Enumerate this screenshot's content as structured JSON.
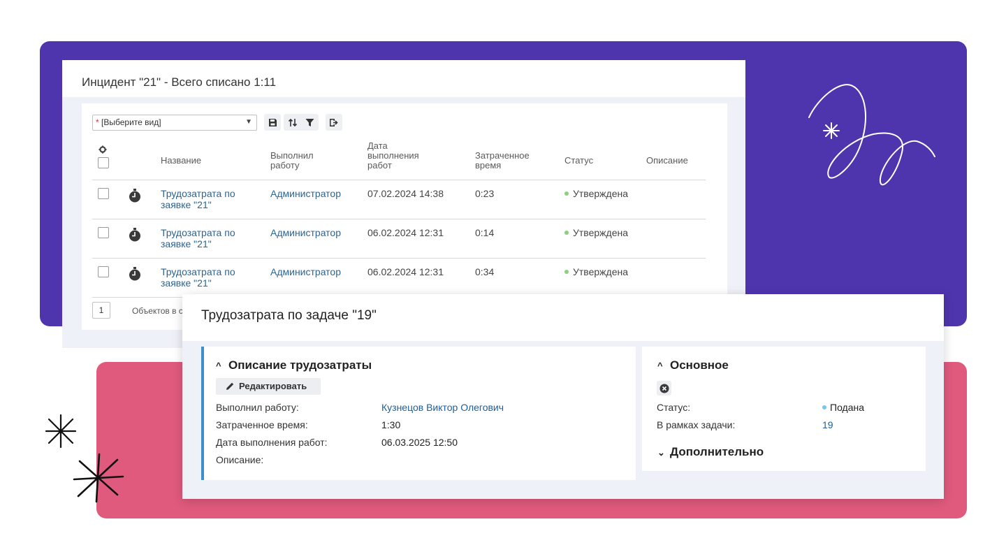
{
  "incident_window": {
    "title": "Инцидент \"21\" - Всего списано 1:11",
    "toolbar": {
      "view_select_required": "*",
      "view_select_value": "[Выберите вид]",
      "icons": [
        "save-icon",
        "sort-icon",
        "filter-icon",
        "export-icon"
      ]
    },
    "columns": [
      "Название",
      "Выполнил работу",
      "Дата выполнения работ",
      "Затраченное время",
      "Статус",
      "Описание"
    ],
    "columns_display": {
      "name": "Название",
      "performer": [
        "Выполнил",
        "работу"
      ],
      "date": [
        "Дата",
        "выполнения",
        "работ"
      ],
      "time": [
        "Затраченное",
        "время"
      ],
      "status": "Статус",
      "description": "Описание"
    },
    "rows": [
      {
        "name": [
          "Трудозатрата по",
          "заявке \"21\""
        ],
        "performer": "Администратор",
        "date": "07.02.2024 14:38",
        "time": "0:23",
        "status": "Утверждена"
      },
      {
        "name": [
          "Трудозатрата по",
          "заявке \"21\""
        ],
        "performer": "Администратор",
        "date": "06.02.2024 12:31",
        "time": "0:14",
        "status": "Утверждена"
      },
      {
        "name": [
          "Трудозатрата по",
          "заявке \"21\""
        ],
        "performer": "Администратор",
        "date": "06.02.2024 12:31",
        "time": "0:34",
        "status": "Утверждена"
      }
    ],
    "pager": {
      "page": "1",
      "summary_text": "Объектов в с"
    }
  },
  "labor_window": {
    "title": "Трудозатрата по задаче \"19\"",
    "description_section": {
      "title": "Описание трудозатраты",
      "edit_label": "Редактировать",
      "fields": [
        {
          "label": "Выполнил работу:",
          "value": "Кузнецов Виктор Олегович"
        },
        {
          "label": "Затраченное время:",
          "value": "1:30"
        },
        {
          "label": "Дата выполнения работ:",
          "value": "06.03.2025 12:50"
        },
        {
          "label": "Описание:",
          "value": ""
        }
      ]
    },
    "main_section": {
      "title": "Основное",
      "fields": [
        {
          "label": "Статус:",
          "value": "Подана"
        },
        {
          "label": "В рамках задачи:",
          "value": "19"
        }
      ]
    },
    "additional_section": {
      "title": "Дополнительно"
    }
  },
  "colors": {
    "purple_bg": "#4e35ad",
    "pink_bg": "#e05a7d",
    "link": "#2a6496",
    "status_approved": "#8bd17c",
    "status_submitted": "#7cc4ef",
    "panel_accent": "#3f8ec9"
  }
}
